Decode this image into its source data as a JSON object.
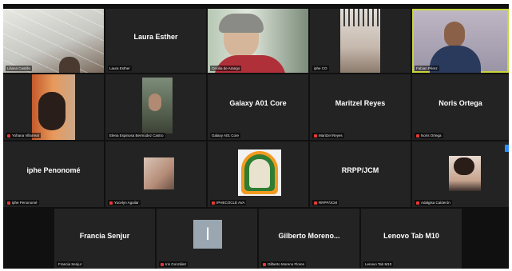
{
  "colors": {
    "background": "#101010",
    "tile": "#232323",
    "active_speaker_border": "#c9d53a",
    "muted_mic": "#e53935",
    "accent_blue": "#2d8cff"
  },
  "participants": [
    {
      "id": "r1c1",
      "display_name": "",
      "label": "Liliana Castillo",
      "muted": false
    },
    {
      "id": "r1c2",
      "display_name": "Laura Esther",
      "label": "Laura Esther",
      "muted": false
    },
    {
      "id": "r1c3",
      "display_name": "",
      "label": "Cecilia de Arango",
      "muted": false
    },
    {
      "id": "r1c4",
      "display_name": "",
      "label": "iphe CO",
      "muted": false
    },
    {
      "id": "r1c5",
      "display_name": "",
      "label": "Fabian Pérez",
      "muted": false
    },
    {
      "id": "r2c1",
      "display_name": "",
      "label": "Yohana Villarreal",
      "muted": true
    },
    {
      "id": "r2c2",
      "display_name": "",
      "label": "Elena Espinosa Bermúdez Castro",
      "muted": false
    },
    {
      "id": "r2c3",
      "display_name": "Galaxy A01 Core",
      "label": "Galaxy A01 Core",
      "muted": false
    },
    {
      "id": "r2c4",
      "display_name": "Maritzel Reyes",
      "label": "Maritzel Reyes",
      "muted": true
    },
    {
      "id": "r2c5",
      "display_name": "Noris Ortega",
      "label": "Noris Ortega",
      "muted": true
    },
    {
      "id": "r3c1",
      "display_name": "iphe Penonomé",
      "label": "iphe Penonomé",
      "muted": true
    },
    {
      "id": "r3c2",
      "display_name": "",
      "label": "Yocelyn Aguilar",
      "muted": true
    },
    {
      "id": "r3c3",
      "display_name": "",
      "label": "IPHECOCLÉ AVA",
      "muted": true
    },
    {
      "id": "r3c4",
      "display_name": "RRPP/JCM",
      "label": "RRPP/JCM",
      "muted": true
    },
    {
      "id": "r3c5",
      "display_name": "",
      "label": "Adalgisa Calderón",
      "muted": true
    },
    {
      "id": "r4c1",
      "display_name": "Francia Senjur",
      "label": "Francia Senjur",
      "muted": false
    },
    {
      "id": "r4c2",
      "display_name": "",
      "label": "Iris González",
      "muted": true
    },
    {
      "id": "r4c3",
      "display_name": "Gilberto Moreno...",
      "label": "Gilberto Moreno Flores",
      "muted": true
    },
    {
      "id": "r4c4",
      "display_name": "Lenovo Tab M10",
      "label": "Lenovo Tab M10",
      "muted": false
    }
  ],
  "avatar_letters": {
    "r4c2": "I"
  }
}
